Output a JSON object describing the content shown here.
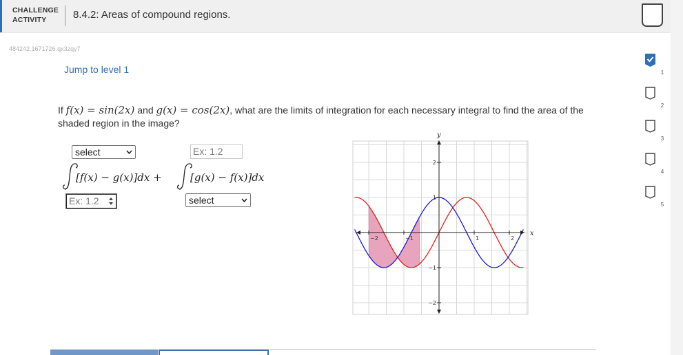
{
  "header": {
    "type_line1": "CHALLENGE",
    "type_line2": "ACTIVITY",
    "title": "8.4.2: Areas of compound regions."
  },
  "activity_code": "484242.1671726.qx3zqy7",
  "jump_link": "Jump to level 1",
  "question": {
    "prefix": "If ",
    "f_def": "f(x) = sin(2x)",
    "and": " and ",
    "g_def": "g(x) = cos(2x)",
    "suffix": ", what are the limits of integration for each necessary integral to find the area of the shaded region in the image?"
  },
  "controls": {
    "select1_value": "select",
    "input1_placeholder": "Ex: 1.2",
    "input2_placeholder": "Ex: 1.2",
    "select2_value": "select"
  },
  "formula": {
    "integrand1": "[f(x) − g(x)]dx +",
    "integrand2": "[g(x) − f(x)]dx"
  },
  "graph": {
    "x_axis_label": "x",
    "y_axis_label": "y",
    "x_ticks": [
      "−2",
      "−1",
      "1",
      "2"
    ],
    "y_ticks": [
      "2",
      "1",
      "−1",
      "−2"
    ],
    "f_color": "#e0201a",
    "g_color": "#1a1ad6",
    "shade_color": "#e8a3bd"
  },
  "levels": {
    "items": [
      "1",
      "2",
      "3",
      "4",
      "5"
    ],
    "active": "1",
    "active_color": "#2f6fb7"
  }
}
